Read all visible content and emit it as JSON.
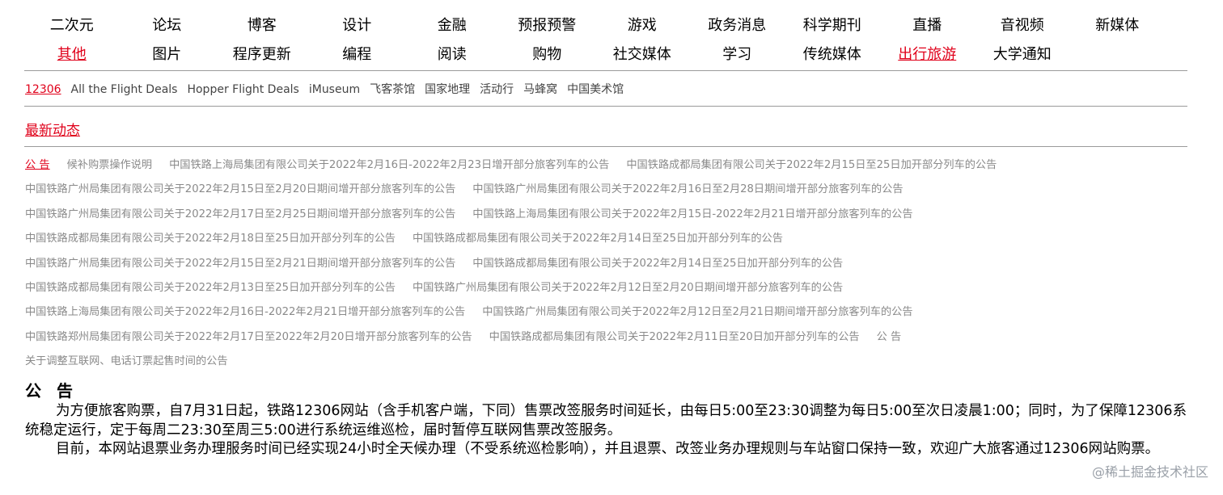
{
  "nav": {
    "row1": [
      "二次元",
      "论坛",
      "博客",
      "设计",
      "金融",
      "预报预警",
      "游戏",
      "政务消息",
      "科学期刊",
      "直播",
      "音视频",
      "新媒体"
    ],
    "row2": [
      "其他",
      "图片",
      "程序更新",
      "编程",
      "阅读",
      "购物",
      "社交媒体",
      "学习",
      "传统媒体",
      "出行旅游",
      "大学通知"
    ]
  },
  "subnav": [
    "12306",
    "All the Flight Deals",
    "Hopper Flight Deals",
    "iMuseum",
    "飞客茶馆",
    "国家地理",
    "活动行",
    "马蜂窝",
    "中国美术馆"
  ],
  "section": {
    "title": "最新动态"
  },
  "feed": [
    [
      "公 告",
      "候补购票操作说明",
      "中国铁路上海局集团有限公司关于2022年2月16日-2022年2月23日增开部分旅客列车的公告",
      "中国铁路成都局集团有限公司关于2022年2月15日至25日加开部分列车的公告"
    ],
    [
      "中国铁路广州局集团有限公司关于2022年2月15日至2月20日期间增开部分旅客列车的公告",
      "中国铁路广州局集团有限公司关于2022年2月16日至2月28日期间增开部分旅客列车的公告"
    ],
    [
      "中国铁路广州局集团有限公司关于2022年2月17日至2月25日期间增开部分旅客列车的公告",
      "中国铁路上海局集团有限公司关于2022年2月15日-2022年2月21日增开部分旅客列车的公告"
    ],
    [
      "中国铁路成都局集团有限公司关于2022年2月18日至25日加开部分列车的公告",
      "中国铁路成都局集团有限公司关于2022年2月14日至25日加开部分列车的公告"
    ],
    [
      "中国铁路广州局集团有限公司关于2022年2月15日至2月21日期间增开部分旅客列车的公告",
      "中国铁路成都局集团有限公司关于2022年2月14日至25日加开部分列车的公告"
    ],
    [
      "中国铁路成都局集团有限公司关于2022年2月13日至25日加开部分列车的公告",
      "中国铁路广州局集团有限公司关于2022年2月12日至2月20日期间增开部分旅客列车的公告"
    ],
    [
      "中国铁路上海局集团有限公司关于2022年2月16日-2022年2月21日增开部分旅客列车的公告",
      "中国铁路广州局集团有限公司关于2022年2月12日至2月21日期间增开部分旅客列车的公告"
    ],
    [
      "中国铁路郑州局集团有限公司关于2022年2月17日至2022年2月20日增开部分旅客列车的公告",
      "中国铁路成都局集团有限公司关于2022年2月11日至20日加开部分列车的公告",
      "公 告"
    ],
    [
      "关于调整互联网、电话订票起售时间的公告"
    ]
  ],
  "notice": {
    "title": "公 告",
    "paragraphs": [
      "为方便旅客购票，自7月31日起，铁路12306网站（含手机客户端，下同）售票改签服务时间延长，由每日5:00至23:30调整为每日5:00至次日凌晨1:00；同时，为了保障12306系统稳定运行，定于每周二23:30至周三5:00进行系统运维巡检，届时暂停互联网售票改签服务。",
      "目前，本网站退票业务办理服务时间已经实现24小时全天候办理（不受系统巡检影响），并且退票、改签业务办理规则与车站窗口保持一致，欢迎广大旅客通过12306网站购票。"
    ]
  },
  "watermark": "@稀土掘金技术社区",
  "colors": {
    "accent": "#e0001a",
    "muted": "#8a8a8a",
    "rule": "#9a9a9a"
  }
}
